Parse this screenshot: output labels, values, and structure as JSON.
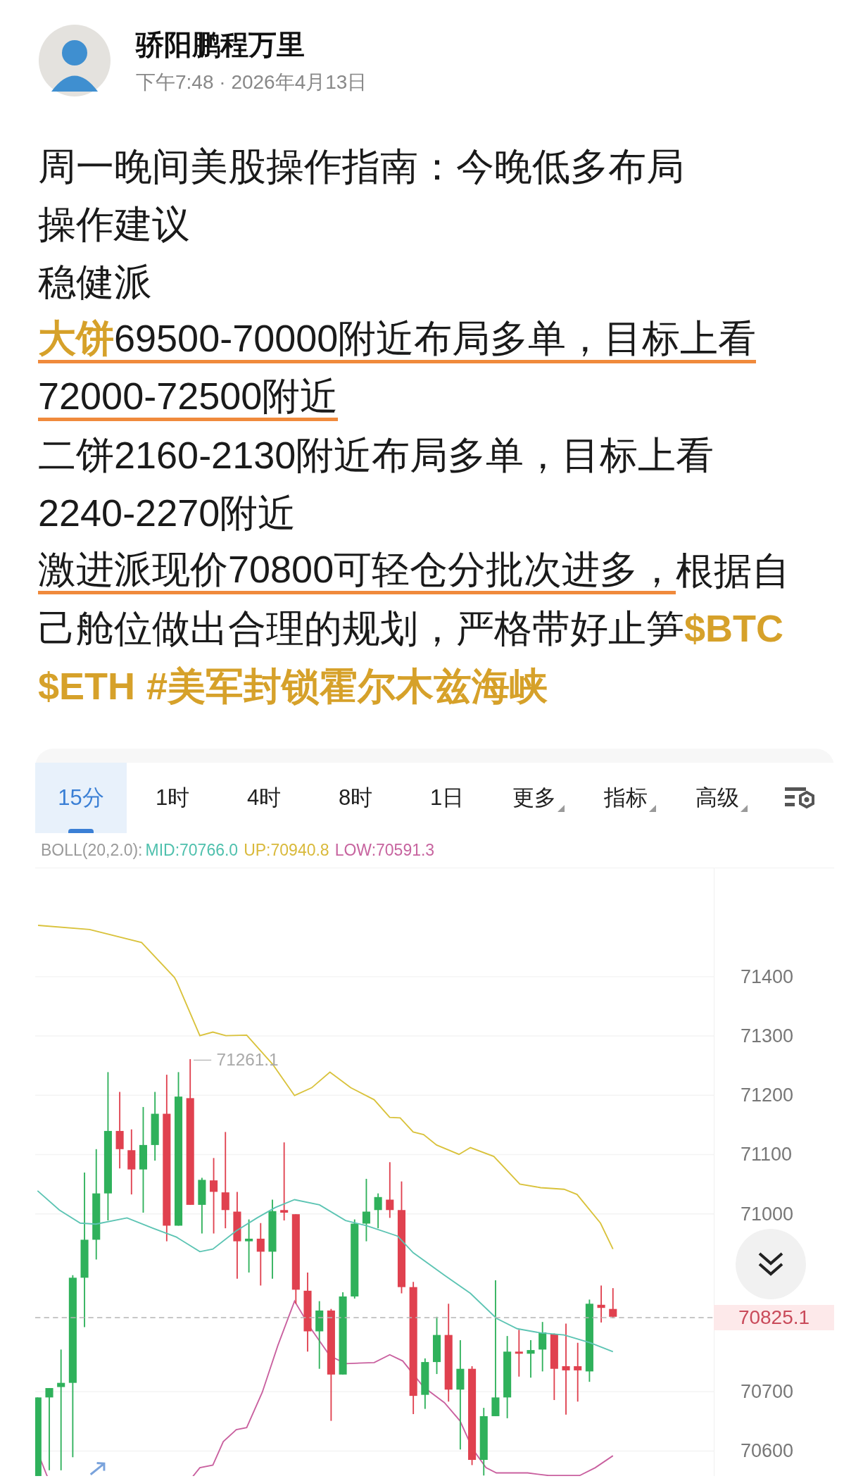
{
  "post": {
    "author": "骄阳鹏程万里",
    "timestamp": "下午7:48 · 2026年4月13日"
  },
  "lines": [
    {
      "segments": [
        {
          "text": "周一晚间美股操作指南：今晚低多布局",
          "kind": "plain",
          "underlined": false
        }
      ]
    },
    {
      "segments": [
        {
          "text": "操作建议",
          "kind": "plain",
          "underlined": false
        }
      ]
    },
    {
      "segments": [
        {
          "text": "稳健派",
          "kind": "plain",
          "underlined": false
        }
      ]
    },
    {
      "segments": [
        {
          "text": "大饼",
          "kind": "tag",
          "underlined": true
        },
        {
          "text": "69500-70000附近布局多单，目标上看",
          "kind": "plain",
          "underlined": true
        }
      ]
    },
    {
      "segments": [
        {
          "text": "72000-72500附近",
          "kind": "plain",
          "underlined": true
        }
      ]
    },
    {
      "segments": [
        {
          "text": "二饼2160-2130附近布局多单，目标上看",
          "kind": "plain",
          "underlined": false
        }
      ]
    },
    {
      "segments": [
        {
          "text": "2240-2270附近",
          "kind": "plain",
          "underlined": false
        }
      ]
    },
    {
      "segments": [
        {
          "text": "激进派现价70800可轻仓分批次进多，",
          "kind": "plain",
          "underlined": true
        },
        {
          "text": "根据自",
          "kind": "plain",
          "underlined": false
        }
      ]
    },
    {
      "segments": [
        {
          "text": "己舱位做出合理的规划，严格带好止笋",
          "kind": "plain",
          "underlined": false
        },
        {
          "text": "$BTC",
          "kind": "tag",
          "underlined": false
        }
      ]
    },
    {
      "segments": [
        {
          "text": "$ETH",
          "kind": "tag",
          "underlined": false
        },
        {
          "text": "#美军封锁霍尔木兹海峡",
          "kind": "tag",
          "underlined": false
        }
      ]
    }
  ],
  "chart": {
    "tabs": [
      {
        "label": "15分",
        "selected": true,
        "dropdown": false
      },
      {
        "label": "1时",
        "selected": false,
        "dropdown": false
      },
      {
        "label": "4时",
        "selected": false,
        "dropdown": false
      },
      {
        "label": "8时",
        "selected": false,
        "dropdown": false
      },
      {
        "label": "1日",
        "selected": false,
        "dropdown": false
      },
      {
        "label": "更多",
        "selected": false,
        "dropdown": true
      },
      {
        "label": "指标",
        "selected": false,
        "dropdown": true
      },
      {
        "label": "高级",
        "selected": false,
        "dropdown": true
      }
    ],
    "boll": {
      "label": "BOLL(20,2.0):",
      "mid": "MID:70766.0",
      "up": "UP:70940.8",
      "low": "LOW:70591.3"
    },
    "y_ticks": [
      "71400",
      "71300",
      "71200",
      "71100",
      "71000",
      "70700",
      "70600"
    ],
    "high_label": "71261.1",
    "last_price": "70825.1"
  }
}
